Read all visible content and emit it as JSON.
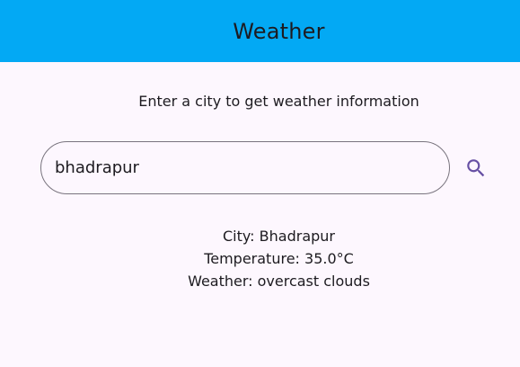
{
  "appbar": {
    "title": "Weather",
    "color": "#03a9f4"
  },
  "prompt": {
    "text": "Enter a city to get weather information"
  },
  "search": {
    "value": "bhadrapur",
    "icon": "search-icon",
    "accent_color": "#6750a4"
  },
  "result": {
    "city": "City: Bhadrapur",
    "temperature": "Temperature: 35.0°C",
    "weather": "Weather: overcast clouds"
  }
}
